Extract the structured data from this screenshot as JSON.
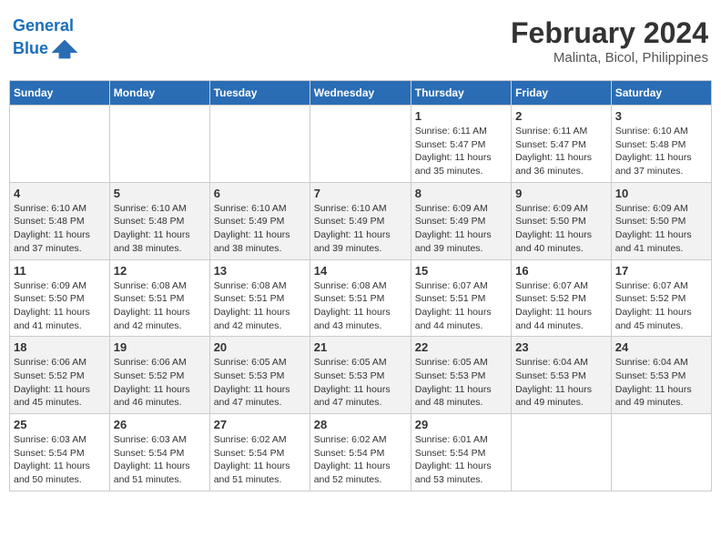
{
  "header": {
    "logo_line1": "General",
    "logo_line2": "Blue",
    "month_year": "February 2024",
    "location": "Malinta, Bicol, Philippines"
  },
  "weekdays": [
    "Sunday",
    "Monday",
    "Tuesday",
    "Wednesday",
    "Thursday",
    "Friday",
    "Saturday"
  ],
  "weeks": [
    [
      {
        "day": "",
        "info": ""
      },
      {
        "day": "",
        "info": ""
      },
      {
        "day": "",
        "info": ""
      },
      {
        "day": "",
        "info": ""
      },
      {
        "day": "1",
        "info": "Sunrise: 6:11 AM\nSunset: 5:47 PM\nDaylight: 11 hours\nand 35 minutes."
      },
      {
        "day": "2",
        "info": "Sunrise: 6:11 AM\nSunset: 5:47 PM\nDaylight: 11 hours\nand 36 minutes."
      },
      {
        "day": "3",
        "info": "Sunrise: 6:10 AM\nSunset: 5:48 PM\nDaylight: 11 hours\nand 37 minutes."
      }
    ],
    [
      {
        "day": "4",
        "info": "Sunrise: 6:10 AM\nSunset: 5:48 PM\nDaylight: 11 hours\nand 37 minutes."
      },
      {
        "day": "5",
        "info": "Sunrise: 6:10 AM\nSunset: 5:48 PM\nDaylight: 11 hours\nand 38 minutes."
      },
      {
        "day": "6",
        "info": "Sunrise: 6:10 AM\nSunset: 5:49 PM\nDaylight: 11 hours\nand 38 minutes."
      },
      {
        "day": "7",
        "info": "Sunrise: 6:10 AM\nSunset: 5:49 PM\nDaylight: 11 hours\nand 39 minutes."
      },
      {
        "day": "8",
        "info": "Sunrise: 6:09 AM\nSunset: 5:49 PM\nDaylight: 11 hours\nand 39 minutes."
      },
      {
        "day": "9",
        "info": "Sunrise: 6:09 AM\nSunset: 5:50 PM\nDaylight: 11 hours\nand 40 minutes."
      },
      {
        "day": "10",
        "info": "Sunrise: 6:09 AM\nSunset: 5:50 PM\nDaylight: 11 hours\nand 41 minutes."
      }
    ],
    [
      {
        "day": "11",
        "info": "Sunrise: 6:09 AM\nSunset: 5:50 PM\nDaylight: 11 hours\nand 41 minutes."
      },
      {
        "day": "12",
        "info": "Sunrise: 6:08 AM\nSunset: 5:51 PM\nDaylight: 11 hours\nand 42 minutes."
      },
      {
        "day": "13",
        "info": "Sunrise: 6:08 AM\nSunset: 5:51 PM\nDaylight: 11 hours\nand 42 minutes."
      },
      {
        "day": "14",
        "info": "Sunrise: 6:08 AM\nSunset: 5:51 PM\nDaylight: 11 hours\nand 43 minutes."
      },
      {
        "day": "15",
        "info": "Sunrise: 6:07 AM\nSunset: 5:51 PM\nDaylight: 11 hours\nand 44 minutes."
      },
      {
        "day": "16",
        "info": "Sunrise: 6:07 AM\nSunset: 5:52 PM\nDaylight: 11 hours\nand 44 minutes."
      },
      {
        "day": "17",
        "info": "Sunrise: 6:07 AM\nSunset: 5:52 PM\nDaylight: 11 hours\nand 45 minutes."
      }
    ],
    [
      {
        "day": "18",
        "info": "Sunrise: 6:06 AM\nSunset: 5:52 PM\nDaylight: 11 hours\nand 45 minutes."
      },
      {
        "day": "19",
        "info": "Sunrise: 6:06 AM\nSunset: 5:52 PM\nDaylight: 11 hours\nand 46 minutes."
      },
      {
        "day": "20",
        "info": "Sunrise: 6:05 AM\nSunset: 5:53 PM\nDaylight: 11 hours\nand 47 minutes."
      },
      {
        "day": "21",
        "info": "Sunrise: 6:05 AM\nSunset: 5:53 PM\nDaylight: 11 hours\nand 47 minutes."
      },
      {
        "day": "22",
        "info": "Sunrise: 6:05 AM\nSunset: 5:53 PM\nDaylight: 11 hours\nand 48 minutes."
      },
      {
        "day": "23",
        "info": "Sunrise: 6:04 AM\nSunset: 5:53 PM\nDaylight: 11 hours\nand 49 minutes."
      },
      {
        "day": "24",
        "info": "Sunrise: 6:04 AM\nSunset: 5:53 PM\nDaylight: 11 hours\nand 49 minutes."
      }
    ],
    [
      {
        "day": "25",
        "info": "Sunrise: 6:03 AM\nSunset: 5:54 PM\nDaylight: 11 hours\nand 50 minutes."
      },
      {
        "day": "26",
        "info": "Sunrise: 6:03 AM\nSunset: 5:54 PM\nDaylight: 11 hours\nand 51 minutes."
      },
      {
        "day": "27",
        "info": "Sunrise: 6:02 AM\nSunset: 5:54 PM\nDaylight: 11 hours\nand 51 minutes."
      },
      {
        "day": "28",
        "info": "Sunrise: 6:02 AM\nSunset: 5:54 PM\nDaylight: 11 hours\nand 52 minutes."
      },
      {
        "day": "29",
        "info": "Sunrise: 6:01 AM\nSunset: 5:54 PM\nDaylight: 11 hours\nand 53 minutes."
      },
      {
        "day": "",
        "info": ""
      },
      {
        "day": "",
        "info": ""
      }
    ]
  ]
}
